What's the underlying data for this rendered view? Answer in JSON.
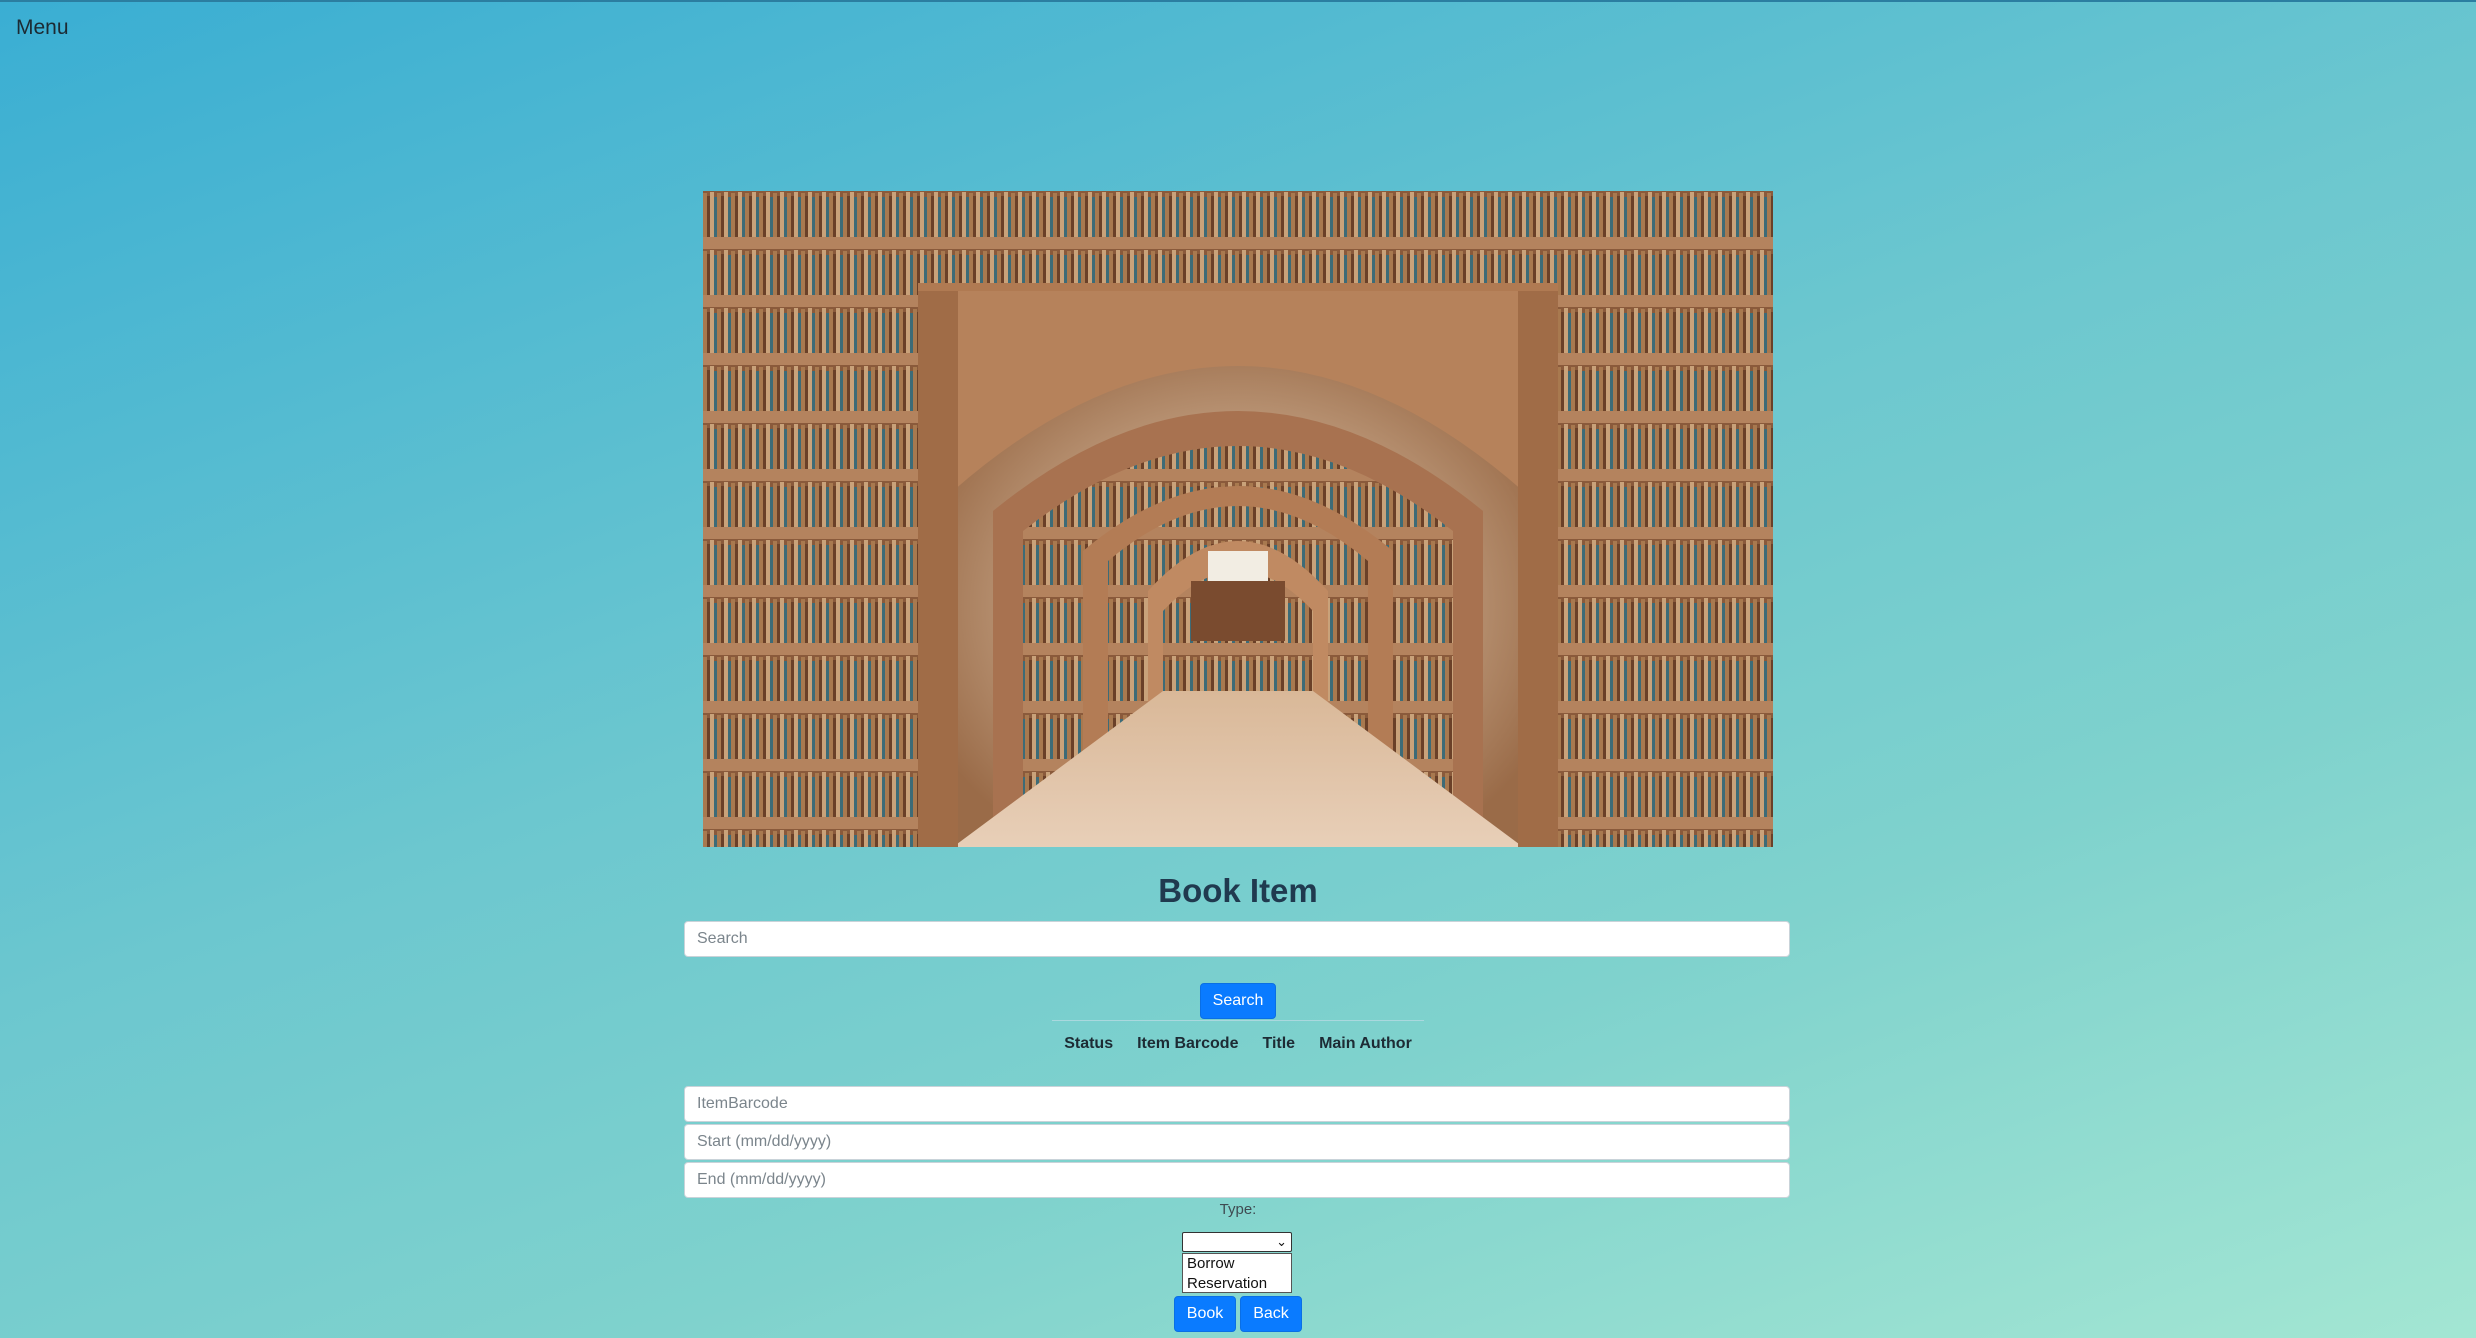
{
  "nav": {
    "menu_label": "Menu"
  },
  "hero": {
    "image": "library-arches-bookshelves"
  },
  "page": {
    "title": "Book Item"
  },
  "search": {
    "placeholder": "Search",
    "button_label": "Search"
  },
  "results_table": {
    "headers": [
      "Status",
      "Item Barcode",
      "Title",
      "Main Author"
    ],
    "rows": []
  },
  "form": {
    "barcode_placeholder": "ItemBarcode",
    "start_placeholder": "Start (mm/dd/yyyy)",
    "end_placeholder": "End (mm/dd/yyyy)",
    "type_label": "Type:",
    "type_selected": "",
    "type_options": [
      "Borrow",
      "Reservation"
    ]
  },
  "actions": {
    "book_label": "Book",
    "back_label": "Back"
  },
  "colors": {
    "primary_button": "#0a7bff",
    "background_start": "#3aaed3",
    "background_end": "#a3e6d3"
  }
}
